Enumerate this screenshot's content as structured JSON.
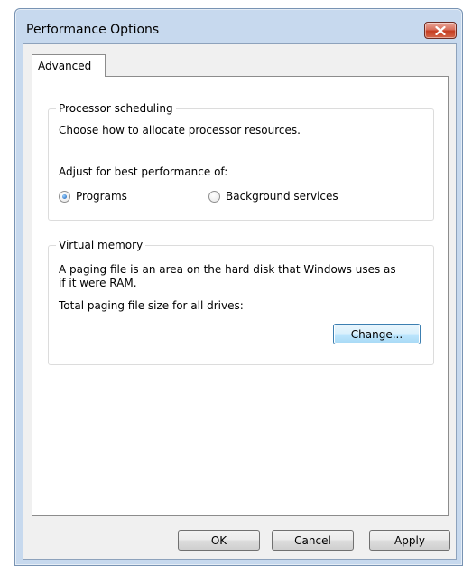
{
  "window": {
    "title": "Performance Options"
  },
  "tabs": [
    {
      "label": "Advanced",
      "selected": true
    }
  ],
  "processor_scheduling": {
    "legend": "Processor scheduling",
    "description": "Choose how to allocate processor resources.",
    "adjust_label": "Adjust for best performance of:",
    "options": [
      {
        "label": "Programs",
        "selected": true
      },
      {
        "label": "Background services",
        "selected": false
      }
    ]
  },
  "virtual_memory": {
    "legend": "Virtual memory",
    "description_line1": "A paging file is an area on the hard disk that Windows uses as",
    "description_line2": "if it were RAM.",
    "total_label": "Total paging file size for all drives:",
    "change_button": "Change..."
  },
  "footer": {
    "ok": "OK",
    "cancel": "Cancel",
    "apply": "Apply"
  },
  "colors": {
    "close_button": "#c53d21",
    "frame": "#c7d9ee",
    "radio_selected": "#2a72c3"
  }
}
